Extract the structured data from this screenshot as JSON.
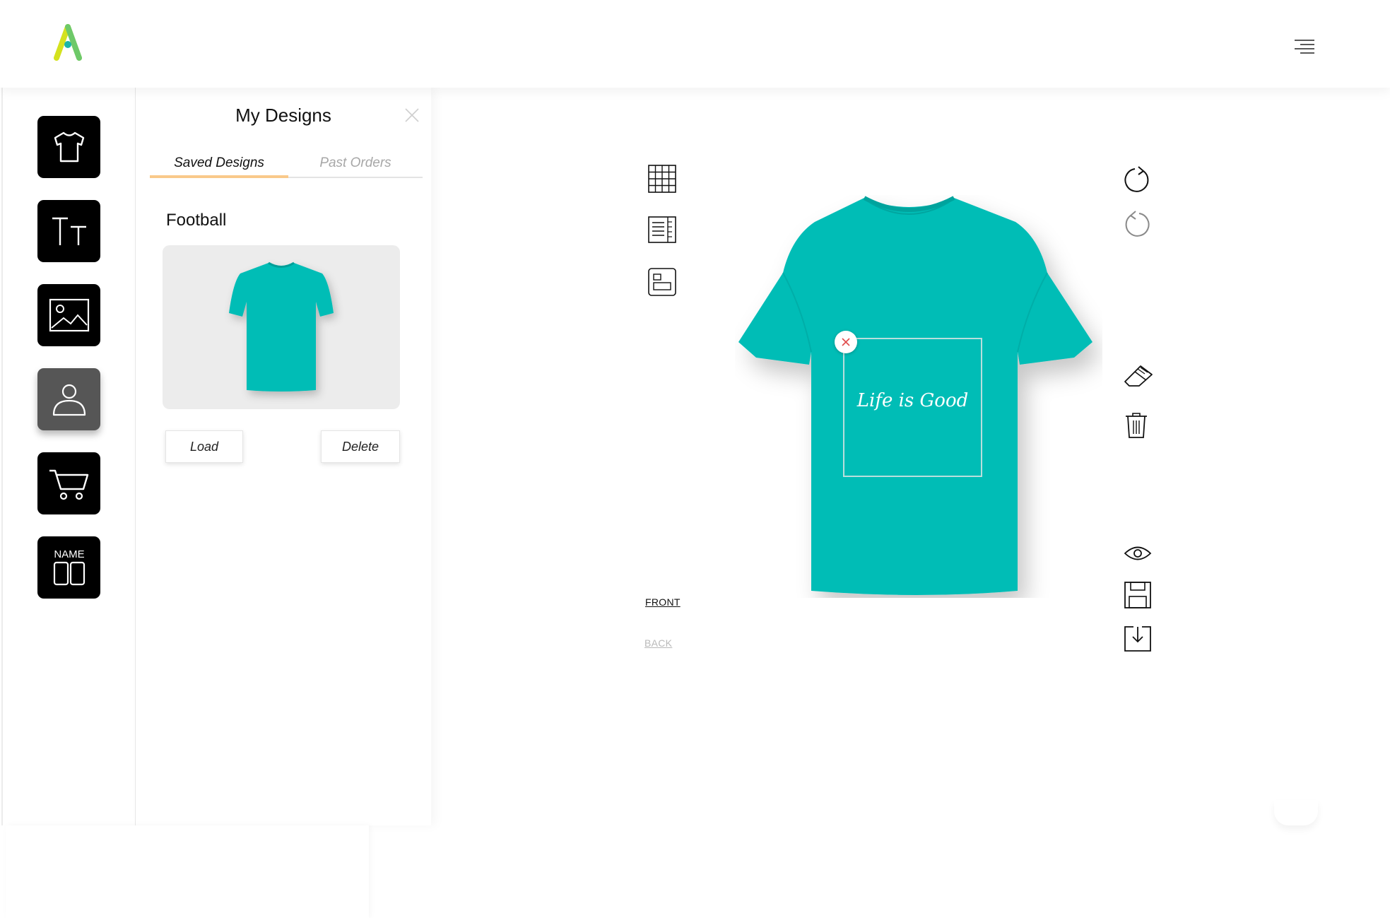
{
  "header": {
    "logo_icon": "app-logo-a",
    "menu_icon": "hamburger-menu-icon"
  },
  "rail": {
    "items": [
      {
        "name": "products",
        "icon": "tshirt-icon",
        "active": false
      },
      {
        "name": "text",
        "icon": "text-tt-icon",
        "active": false
      },
      {
        "name": "images",
        "icon": "image-icon",
        "active": false
      },
      {
        "name": "my-designs",
        "icon": "user-icon",
        "active": true
      },
      {
        "name": "cart",
        "icon": "cart-icon",
        "active": false
      },
      {
        "name": "names-numbers",
        "icon": "name-number-icon",
        "label": "NAME",
        "active": false
      }
    ]
  },
  "panel": {
    "title": "My Designs",
    "tabs": [
      {
        "label": "Saved Designs",
        "active": true
      },
      {
        "label": "Past Orders",
        "active": false
      }
    ],
    "designs": [
      {
        "name": "Football",
        "shirt_color": "#00bdb6"
      }
    ],
    "buttons": {
      "load": "Load",
      "delete": "Delete"
    }
  },
  "canvas": {
    "left_tools": [
      "grid-icon",
      "rulers-icon",
      "layout-icon"
    ],
    "right_tools": [
      "redo-icon",
      "undo-icon",
      "eraser-icon",
      "trash-icon",
      "preview-eye-icon",
      "save-icon",
      "download-icon"
    ],
    "views": {
      "front": "FRONT",
      "back": "BACK",
      "active": "front"
    },
    "shirt_color": "#00bdb6",
    "print_text": "Life is Good"
  },
  "colors": {
    "accent_tab": "#f9c98a",
    "tool_bg": "#000000",
    "tool_active_bg": "#565656",
    "logo_yellow": "#d4e21e",
    "logo_teal": "#19b5a8"
  }
}
